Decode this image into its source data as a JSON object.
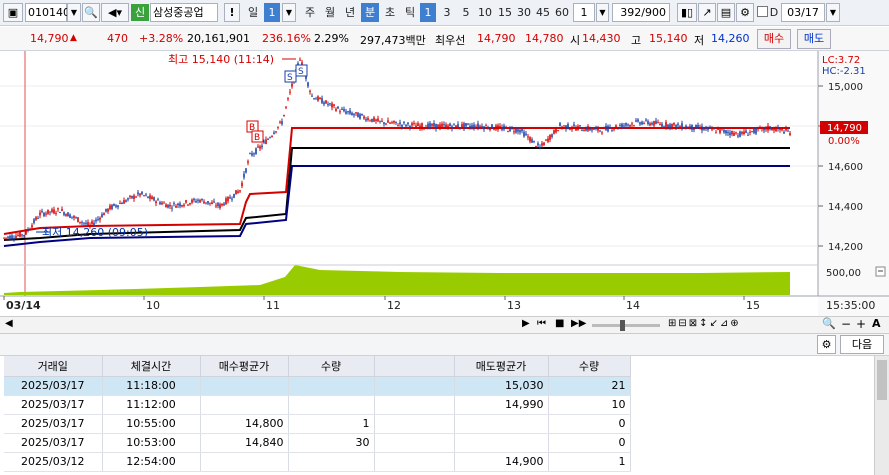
{
  "toolbar": {
    "code": "010140",
    "credit_badge": "신",
    "stock_name": "삼성중공업",
    "alert": "!",
    "period_day": "일",
    "period_sel": "1",
    "periods": [
      "주",
      "월",
      "년"
    ],
    "period_min": "분",
    "period_sec": "초",
    "period_tick": "틱",
    "intervals": [
      "1",
      "3",
      "5",
      "10",
      "15",
      "30",
      "45",
      "60"
    ],
    "interval_value": "1",
    "count": "392/900",
    "date_label": "D",
    "date_value": "03/17"
  },
  "price": {
    "current": "14,790",
    "change": "470",
    "change_pct": "+3.28%",
    "volume": "20,161,901",
    "vol_ratio": "236.16%",
    "turnover_pct": "2.29%",
    "amount": "297,473백만",
    "ask_label": "최우선",
    "ask": "14,790",
    "bid": "14,780",
    "open_label": "시",
    "open": "14,430",
    "high_label": "고",
    "high": "15,140",
    "low_label": "저",
    "low": "14,260",
    "buy_button": "매수",
    "sell_button": "매도"
  },
  "chart": {
    "high_marker": "최고 15,140 (11:14)",
    "low_marker": "최저 14,260 (09:05)",
    "lc": "LC:3.72",
    "hc": "HC:-2.31",
    "y_labels": [
      "15,000",
      "14,800",
      "14,600",
      "14,400",
      "14,200"
    ],
    "current_tag": "14,790",
    "current_pct": "0.00%",
    "volume_label": "500,00",
    "time_label": "15:35:00",
    "x_labels": [
      "03/14",
      "10",
      "11",
      "12",
      "13",
      "14",
      "15"
    ],
    "colors": {
      "up": "#d40000",
      "down": "#1a3fa8",
      "volume": "#99cc00",
      "ma1": "#d40000",
      "ma2": "#000000",
      "ma3": "#000080"
    }
  },
  "grid": {
    "next_button": "다음",
    "headers": [
      "거래일",
      "체결시간",
      "매수평균가",
      "수량",
      "",
      "매도평균가",
      "수량"
    ],
    "rows": [
      [
        "2025/03/17",
        "11:18:00",
        "",
        "",
        "",
        "15,030",
        "21"
      ],
      [
        "2025/03/17",
        "11:12:00",
        "",
        "",
        "",
        "14,990",
        "10"
      ],
      [
        "2025/03/17",
        "10:55:00",
        "14,800",
        "1",
        "",
        "",
        "0"
      ],
      [
        "2025/03/17",
        "10:53:00",
        "14,840",
        "30",
        "",
        "",
        "0"
      ],
      [
        "2025/03/12",
        "12:54:00",
        "",
        "",
        "",
        "14,900",
        "1"
      ]
    ]
  }
}
